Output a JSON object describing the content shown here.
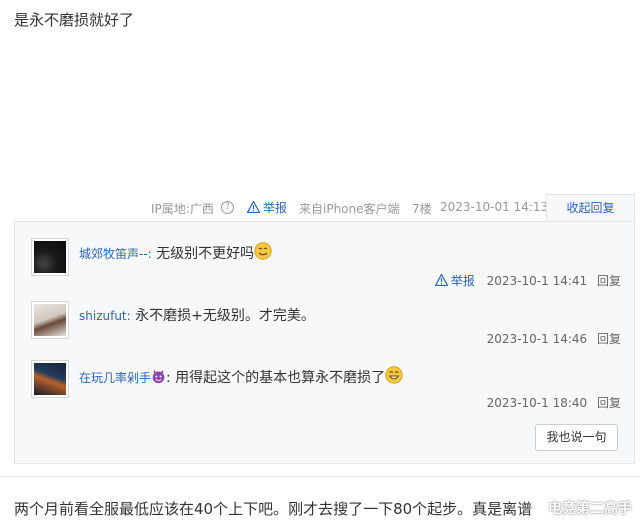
{
  "post": {
    "text": "是永不磨损就好了"
  },
  "meta": {
    "ip": "IP属地:广西",
    "help_glyph": "?",
    "report_label": "举报",
    "source": "来自iPhone客户端",
    "floor": "7楼",
    "date": "2023-10-01 14:13",
    "collapse_label": "收起回复"
  },
  "replies": [
    {
      "user": "城郊牧笛声--:",
      "text": " 无级别不更好吗",
      "emoji": "smile-emoji",
      "time": "2023-10-1 14:41",
      "reply_label": "回复",
      "report_label": "举报"
    },
    {
      "user": "shizufut:",
      "text": " 永不磨损+无级别。才完美。",
      "time": "2023-10-1 14:46",
      "reply_label": "回复"
    },
    {
      "user": "在玩几率剁手",
      "user_emoji": "devil-emoji",
      "text": ": 用得起这个的基本也算永不磨损了",
      "emoji": "grin-emoji",
      "time": "2023-10-1 18:40",
      "reply_label": "回复"
    }
  ],
  "say_button": "我也说一句",
  "next_post": {
    "text": "两个月前看全服最低应该在40个上下吧。刚才去搜了一下80个起步。真是离谱"
  },
  "watermark": "电竞第二高手",
  "colors": {
    "link": "#2d64b3",
    "reply_bg": "#f7f8fa"
  }
}
